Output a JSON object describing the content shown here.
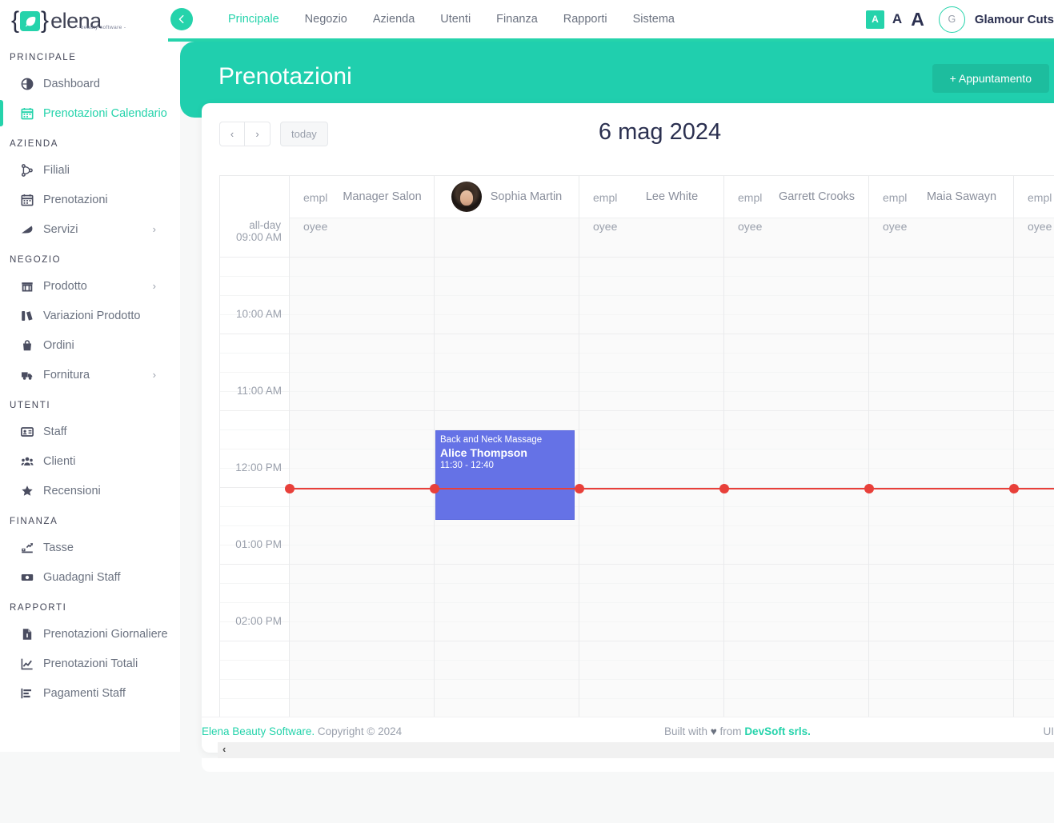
{
  "brand": {
    "name": "elena",
    "tagline": "- beauty software -",
    "accent": "#25d3ab"
  },
  "sidebar": {
    "groups": [
      {
        "title": "PRINCIPALE",
        "items": [
          {
            "label": "Dashboard",
            "icon": "dashboard-icon",
            "active": false,
            "chevron": false
          },
          {
            "label": "Prenotazioni Calendario",
            "icon": "calendar-icon",
            "active": true,
            "chevron": false
          }
        ]
      },
      {
        "title": "AZIENDA",
        "items": [
          {
            "label": "Filiali",
            "icon": "branch-icon",
            "active": false,
            "chevron": false
          },
          {
            "label": "Prenotazioni",
            "icon": "calendar-icon",
            "active": false,
            "chevron": false
          },
          {
            "label": "Servizi",
            "icon": "services-icon",
            "active": false,
            "chevron": true
          }
        ]
      },
      {
        "title": "NEGOZIO",
        "items": [
          {
            "label": "Prodotto",
            "icon": "store-icon",
            "active": false,
            "chevron": true
          },
          {
            "label": "Variazioni Prodotto",
            "icon": "variations-icon",
            "active": false,
            "chevron": false
          },
          {
            "label": "Ordini",
            "icon": "bag-icon",
            "active": false,
            "chevron": false
          },
          {
            "label": "Fornitura",
            "icon": "truck-icon",
            "active": false,
            "chevron": true
          }
        ]
      },
      {
        "title": "UTENTI",
        "items": [
          {
            "label": "Staff",
            "icon": "id-card-icon",
            "active": false,
            "chevron": false
          },
          {
            "label": "Clienti",
            "icon": "people-icon",
            "active": false,
            "chevron": false
          },
          {
            "label": "Recensioni",
            "icon": "star-icon",
            "active": false,
            "chevron": false
          }
        ]
      },
      {
        "title": "FINANZA",
        "items": [
          {
            "label": "Tasse",
            "icon": "tax-icon",
            "active": false,
            "chevron": false
          },
          {
            "label": "Guadagni Staff",
            "icon": "money-icon",
            "active": false,
            "chevron": false
          }
        ]
      },
      {
        "title": "RAPPORTI",
        "items": [
          {
            "label": "Prenotazioni Giornaliere",
            "icon": "report-doc-icon",
            "active": false,
            "chevron": false
          },
          {
            "label": "Prenotazioni Totali",
            "icon": "line-chart-icon",
            "active": false,
            "chevron": false
          },
          {
            "label": "Pagamenti Staff",
            "icon": "bar-chart-icon",
            "active": false,
            "chevron": false
          }
        ]
      }
    ]
  },
  "topnav": {
    "back_icon": "arrow-left-icon",
    "tabs": [
      {
        "label": "Principale",
        "active": true
      },
      {
        "label": "Negozio",
        "active": false
      },
      {
        "label": "Azienda",
        "active": false
      },
      {
        "label": "Utenti",
        "active": false
      },
      {
        "label": "Finanza",
        "active": false
      },
      {
        "label": "Rapporti",
        "active": false
      },
      {
        "label": "Sistema",
        "active": false
      }
    ],
    "font_sizes": [
      {
        "label": "A",
        "selected": true
      },
      {
        "label": "A",
        "selected": false
      },
      {
        "label": "A",
        "selected": false
      }
    ],
    "avatar_initial": "G",
    "user_name": "Glamour Cuts"
  },
  "page": {
    "title": "Prenotazioni",
    "add_button": "+ Appuntamento"
  },
  "calendar": {
    "prev_label": "‹",
    "next_label": "›",
    "today_label": "today",
    "current_date": "6 mag 2024",
    "allday_label": "all-day",
    "employee_alt_text": "employee",
    "columns": [
      {
        "name": "Manager Salon",
        "has_photo": false
      },
      {
        "name": "Sophia Martin",
        "has_photo": true
      },
      {
        "name": "Lee White",
        "has_photo": false
      },
      {
        "name": "Garrett Crooks",
        "has_photo": false
      },
      {
        "name": "Maia Sawayn",
        "has_photo": false
      },
      {
        "name": "",
        "has_photo": false
      }
    ],
    "time_labels": [
      "09:00 AM",
      "10:00 AM",
      "11:00 AM",
      "12:00 PM",
      "01:00 PM",
      "02:00 PM"
    ],
    "events": [
      {
        "service": "Back and Neck Massage",
        "client": "Alice Thompson",
        "time": "11:30 - 12:40",
        "column": 1,
        "color": "#6572e6"
      }
    ],
    "now_indicator_color": "#e8403a"
  },
  "footer": {
    "brand": "Elena Beauty Software.",
    "copyright": " Copyright © 2024",
    "built_prefix": "Built with ",
    "heart": "♥",
    "built_middle": " from ",
    "built_link": "DevSoft srls.",
    "right_text": "UI"
  }
}
